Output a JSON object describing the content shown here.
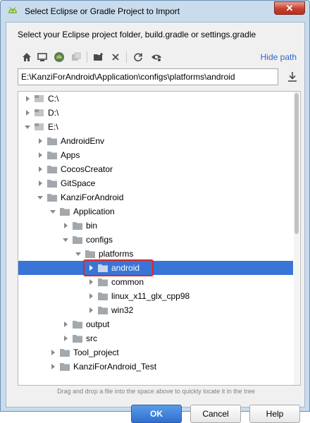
{
  "window": {
    "title": "Select Eclipse or Gradle Project to Import",
    "close_label": "✕"
  },
  "prompt": "Select your Eclipse project folder, build.gradle or settings.gradle",
  "toolbar": {
    "icons": [
      "home-icon",
      "desktop-icon",
      "android-project-icon",
      "module-icon",
      "new-folder-icon",
      "delete-icon",
      "refresh-icon",
      "show-hidden-icon"
    ],
    "hide_path_label": "Hide path"
  },
  "path_field": {
    "value": "E:\\KanziForAndroid\\Application\\configs\\platforms\\android"
  },
  "tree": {
    "items": [
      {
        "label": "C:\\",
        "expanded": false
      },
      {
        "label": "D:\\",
        "expanded": false
      },
      {
        "label": "E:\\",
        "expanded": true
      },
      {
        "label": "AndroidEnv",
        "expanded": false
      },
      {
        "label": "Apps",
        "expanded": false
      },
      {
        "label": "CocosCreator",
        "expanded": false
      },
      {
        "label": "GitSpace",
        "expanded": false
      },
      {
        "label": "KanziForAndroid",
        "expanded": true
      },
      {
        "label": "Application",
        "expanded": true
      },
      {
        "label": "bin",
        "expanded": false
      },
      {
        "label": "configs",
        "expanded": true
      },
      {
        "label": "platforms",
        "expanded": true
      },
      {
        "label": "android",
        "expanded": false,
        "selected": true
      },
      {
        "label": "common",
        "expanded": false
      },
      {
        "label": "linux_x11_glx_cpp98",
        "expanded": false
      },
      {
        "label": "win32",
        "expanded": false
      },
      {
        "label": "output",
        "expanded": false
      },
      {
        "label": "src",
        "expanded": false
      },
      {
        "label": "Tool_project",
        "expanded": false
      },
      {
        "label": "KanziForAndroid_Test",
        "expanded": false
      }
    ]
  },
  "hint": "Drag and drop a file into the space above to quickly locate it in the tree",
  "buttons": {
    "ok": "OK",
    "cancel": "Cancel",
    "help": "Help"
  },
  "colors": {
    "selection": "#3875d7",
    "highlight_box": "#e0271f",
    "link": "#2f65ca",
    "ok_button": "#2f6fd0"
  }
}
